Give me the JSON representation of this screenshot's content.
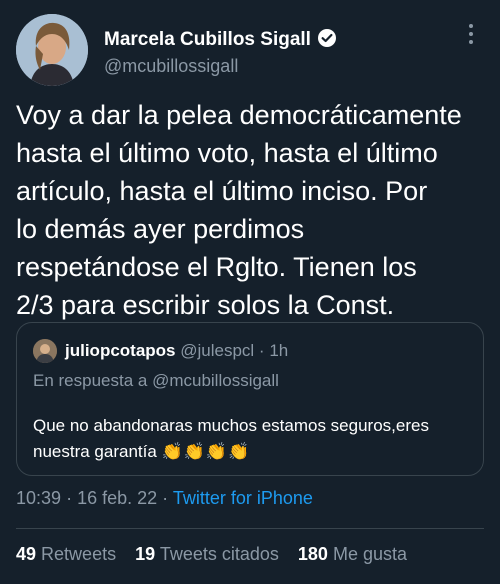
{
  "author": {
    "name": "Marcela Cubillos Sigall",
    "handle": "@mcubillossigall",
    "verified": true
  },
  "tweet": {
    "text": "Voy a dar la pelea democráticamente\nhasta el último voto, hasta el último\nartículo, hasta el último inciso. Por\nlo demás ayer perdimos\nrespetándose el Rglto. Tienen los\n2/3 para escribir solos la Const."
  },
  "quote": {
    "name": "juliopcotapos",
    "handle": "@julespcl",
    "separator": "·",
    "time": "1h",
    "reply_to": "En respuesta a @mcubillossigall",
    "text": "Que no abandonaras muchos estamos seguros,eres nuestra garantía",
    "emoji": "👏👏👏👏"
  },
  "meta": {
    "time": "10:39",
    "dot": "·",
    "date": "16 feb. 22",
    "source": "Twitter for iPhone"
  },
  "stats": {
    "retweets_count": "49",
    "retweets_label": "Retweets",
    "quotes_count": "19",
    "quotes_label": "Tweets citados",
    "likes_count": "180",
    "likes_label": "Me gusta"
  },
  "colors": {
    "background": "#15202b",
    "secondary_text": "#8b98a5",
    "link": "#1d9bf0",
    "border": "#38444d"
  }
}
